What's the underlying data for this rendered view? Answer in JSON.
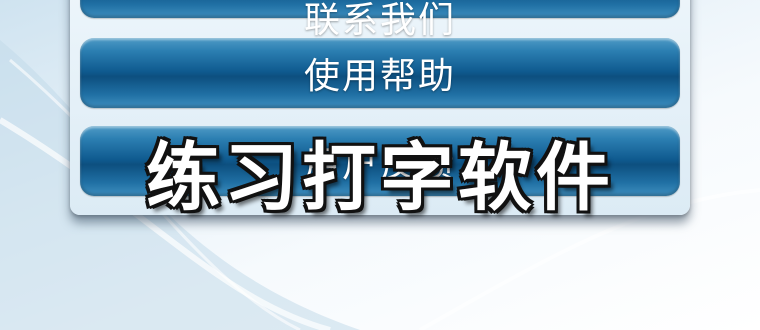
{
  "menu": {
    "top_partial_label": "联系我们",
    "help_label": "使用帮助",
    "feedback_label": "用户反馈"
  },
  "overlay": {
    "title": "练习打字软件"
  },
  "colors": {
    "button_dark": "#0d4f7f",
    "button_light": "#4f9bc6",
    "panel_bg": "#dcebf5"
  }
}
